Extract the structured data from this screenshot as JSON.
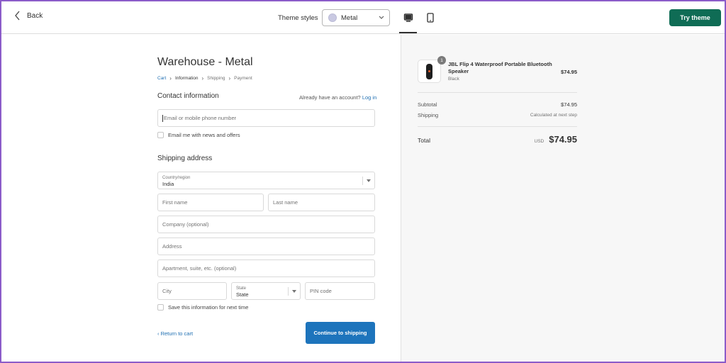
{
  "topbar": {
    "back_label": "Back",
    "theme_styles_label": "Theme styles",
    "theme_value": "Metal",
    "try_theme_label": "Try theme"
  },
  "checkout": {
    "store_title": "Warehouse - Metal",
    "breadcrumbs": [
      "Cart",
      "Information",
      "Shipping",
      "Payment"
    ],
    "contact_title": "Contact information",
    "account_prompt": "Already have an account?",
    "login_label": "Log in",
    "email_placeholder": "Email or mobile phone number",
    "email_news_label": "Email me with news and offers",
    "shipping_title": "Shipping address",
    "country_label": "Country/region",
    "country_value": "India",
    "first_name_placeholder": "First name",
    "last_name_placeholder": "Last name",
    "company_placeholder": "Company (optional)",
    "address_placeholder": "Address",
    "apartment_placeholder": "Apartment, suite, etc. (optional)",
    "city_placeholder": "City",
    "state_label": "State",
    "state_value": "State",
    "pin_placeholder": "PIN code",
    "save_info_label": "Save this information for next time",
    "return_label": "Return to cart",
    "continue_label": "Continue to shipping"
  },
  "summary": {
    "product_name": "JBL Flip 4 Waterproof Portable Bluetooth Speaker",
    "product_variant": "Black",
    "product_qty": "1",
    "product_price": "$74.95",
    "subtotal_label": "Subtotal",
    "subtotal_value": "$74.95",
    "shipping_label": "Shipping",
    "shipping_value": "Calculated at next step",
    "total_label": "Total",
    "currency": "USD",
    "total_value": "$74.95"
  },
  "colors": {
    "accent_button": "#1d74bc",
    "try_theme": "#0f6c55",
    "link": "#1f6fb2"
  }
}
